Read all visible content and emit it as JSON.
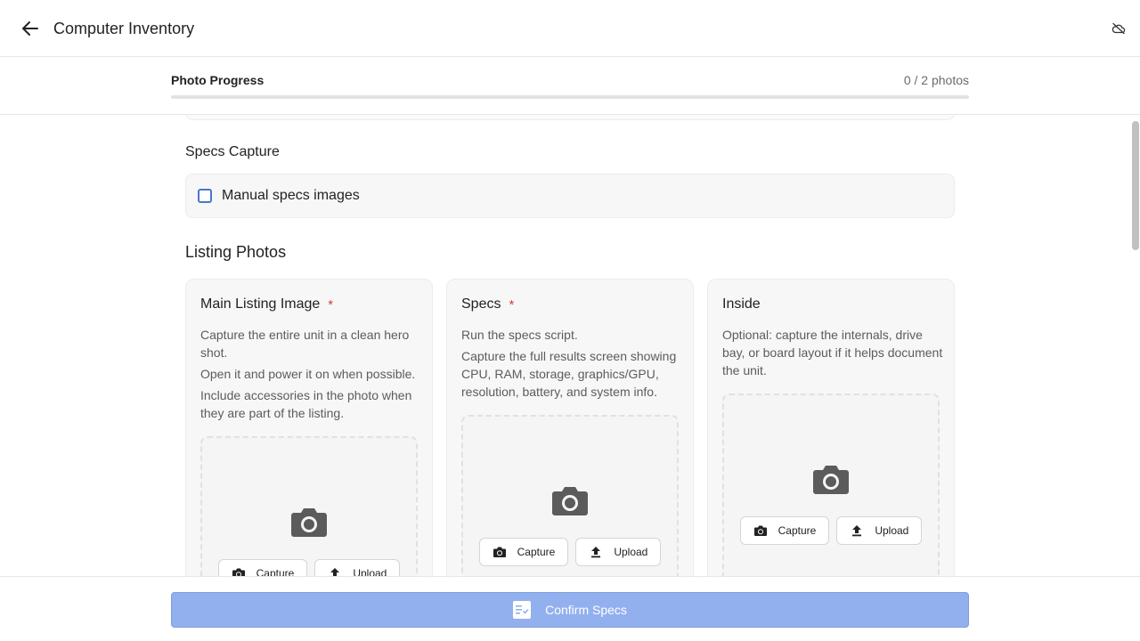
{
  "appbar": {
    "title": "Computer Inventory",
    "back_icon": "arrow-left-icon",
    "status_icon": "cloud-off-icon"
  },
  "progress": {
    "label": "Photo Progress",
    "count_text": "0 / 2 photos",
    "fraction": 0
  },
  "specs_capture": {
    "title": "Specs Capture",
    "checkbox_label": "Manual specs images",
    "checked": false
  },
  "listing_photos": {
    "title": "Listing Photos",
    "cards": [
      {
        "title": "Main Listing Image",
        "required": "*",
        "desc": [
          "Capture the entire unit in a clean hero shot.",
          "Open it and power it on when possible.",
          "Include accessories in the photo when they are part of the listing."
        ],
        "capture_label": "Capture",
        "upload_label": "Upload"
      },
      {
        "title": "Specs",
        "required": "*",
        "desc": [
          "Run the specs script.",
          "Capture the full results screen showing CPU, RAM, storage, graphics/GPU, resolution, battery, and system info."
        ],
        "capture_label": "Capture",
        "upload_label": "Upload"
      },
      {
        "title": "Inside",
        "required": "",
        "desc": [
          "Optional: capture the internals, drive bay, or board layout if it helps document the unit."
        ],
        "capture_label": "Capture",
        "upload_label": "Upload"
      }
    ]
  },
  "bottom": {
    "confirm_label": "Confirm Specs",
    "confirm_icon": "checklist-icon"
  },
  "colors": {
    "accent": "#93b0ee",
    "checkbox": "#4a77c9",
    "required": "#d04040"
  }
}
